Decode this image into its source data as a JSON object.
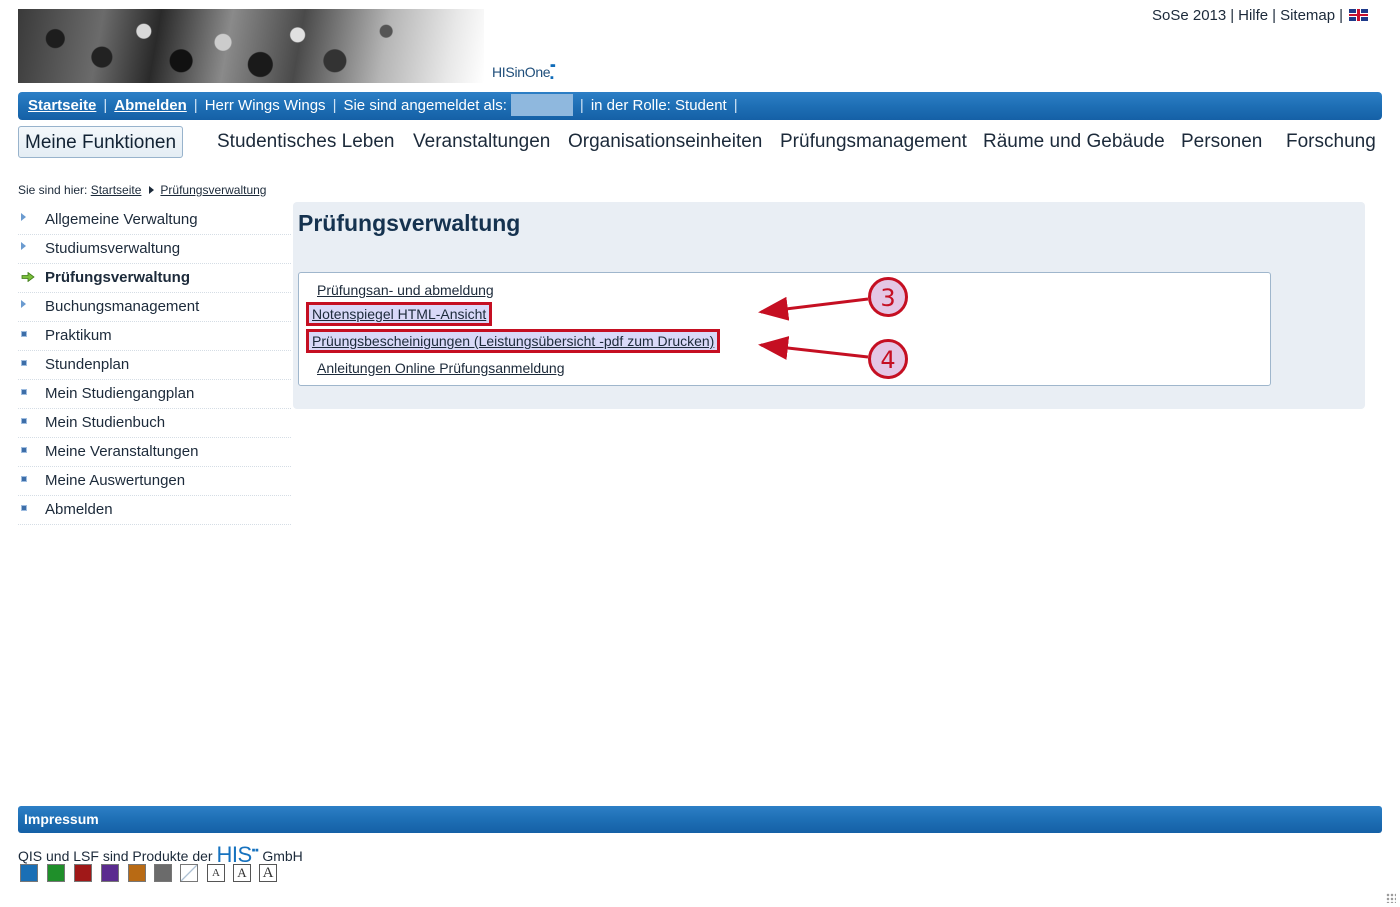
{
  "header": {
    "logo_text": "HISinOne",
    "top_links": [
      "SoSe 2013",
      "Hilfe",
      "Sitemap"
    ],
    "separator": "|"
  },
  "userbar": {
    "home": "Startseite",
    "logout": "Abmelden",
    "user": "Herr Wings Wings",
    "logged_in_as": "Sie sind angemeldet als:",
    "role": "in der Rolle: Student",
    "separator": "|"
  },
  "mainnav": {
    "tabs": [
      {
        "label": "Meine Funktionen",
        "active": true
      },
      {
        "label": "Studentisches Leben",
        "active": false
      },
      {
        "label": "Veranstaltungen",
        "active": false
      },
      {
        "label": "Organisationseinheiten",
        "active": false
      },
      {
        "label": "Prüfungsmanagement",
        "active": false
      },
      {
        "label": "Räume und Gebäude",
        "active": false
      },
      {
        "label": "Personen",
        "active": false
      },
      {
        "label": "Forschung",
        "active": false
      }
    ]
  },
  "breadcrumb": {
    "prefix": "Sie sind hier:",
    "items": [
      "Startseite",
      "Prüfungsverwaltung"
    ]
  },
  "sidebar": {
    "items": [
      {
        "label": "Allgemeine Verwaltung",
        "icon": "triangle-icon"
      },
      {
        "label": "Studiumsverwaltung",
        "icon": "triangle-icon"
      },
      {
        "label": "Prüfungsverwaltung",
        "icon": "green-arrow-icon",
        "active": true
      },
      {
        "label": "Buchungsmanagement",
        "icon": "triangle-icon"
      },
      {
        "label": "Praktikum",
        "icon": "square-icon"
      },
      {
        "label": "Stundenplan",
        "icon": "square-icon"
      },
      {
        "label": "Mein Studiengangplan",
        "icon": "square-icon"
      },
      {
        "label": "Mein Studienbuch",
        "icon": "square-icon"
      },
      {
        "label": "Meine Veranstaltungen",
        "icon": "square-icon"
      },
      {
        "label": "Meine Auswertungen",
        "icon": "square-icon"
      },
      {
        "label": "Abmelden",
        "icon": "square-icon"
      }
    ]
  },
  "content": {
    "title": "Prüfungsverwaltung",
    "links": [
      "Prüfungsan- und abmeldung",
      "Notenspiegel HTML-Ansicht",
      "Prüungsbescheinigungen (Leistungsübersicht -pdf zum Drucken)",
      "Anleitungen Online Prüfungsanmeldung"
    ]
  },
  "annotations": [
    {
      "number": "3",
      "target": "Notenspiegel HTML-Ansicht"
    },
    {
      "number": "4",
      "target": "Prüungsbescheinigungen (Leistungsübersicht -pdf zum Drucken)"
    }
  ],
  "footer": {
    "impressum": "Impressum",
    "products_text": "QIS und LSF sind Produkte der",
    "his_logo": "HIS",
    "gmbh": "GmbH",
    "color_swatches": [
      "#1a6fb5",
      "#1f8f2a",
      "#a01818",
      "#5b2c8f",
      "#b86a14",
      "#6b6b6b",
      "#e8eef5"
    ],
    "font_sizes": [
      "A",
      "A",
      "A"
    ]
  },
  "colors": {
    "accent_blue": "#1e6fb5",
    "annotation_red": "#c50f22",
    "highlight": "#d9d9f8"
  }
}
